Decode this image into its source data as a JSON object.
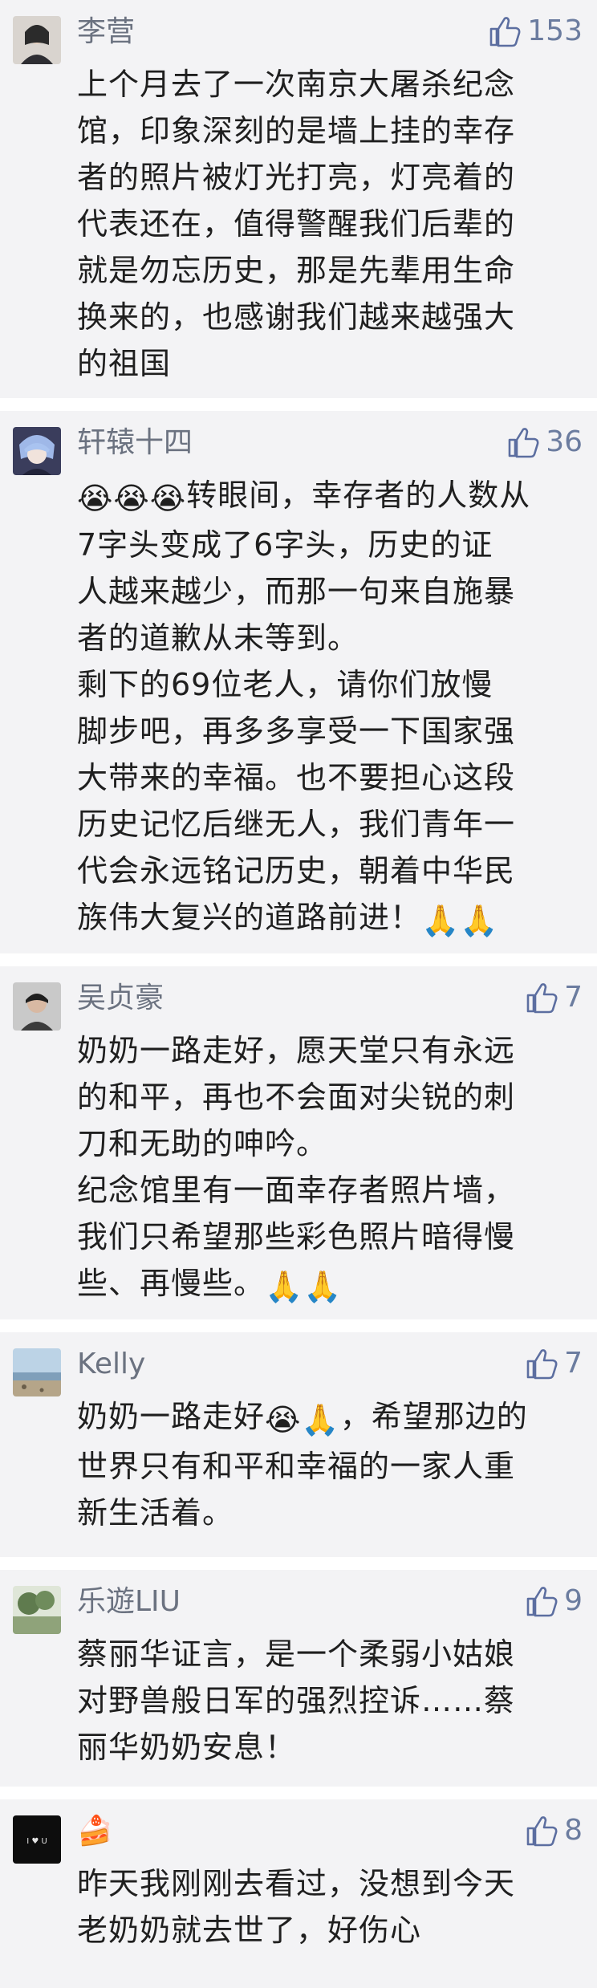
{
  "comments": [
    {
      "user": "李营",
      "likes": "153",
      "avatar": "portrait-avatar",
      "paragraphs": [
        "上个月去了一次南京大屠杀纪念\n馆，印象深刻的是墙上挂的幸存\n者的照片被灯光打亮，灯亮着的\n代表还在，值得警醒我们后辈的\n就是勿忘历史，那是先辈用生命\n换来的，也感谢我们越来越强大\n的祖国"
      ]
    },
    {
      "user": "轩辕十四",
      "likes": "36",
      "avatar": "anime-avatar",
      "emoji_prefix": "😭😭😭",
      "paragraphs": [
        "转眼间，幸存者的人数从\n7字头变成了6字头，历史的证\n人越来越少，而那一句来自施暴\n者的道歉从未等到。",
        "剩下的69位老人，请你们放慢\n脚步吧，再多多享受一下国家强\n大带来的幸福。也不要担心这段\n历史记忆后继无人，我们青年一\n代会永远铭记历史，朝着中华民\n族伟大复兴的道路前进！"
      ],
      "emoji_suffix": "🙏🙏"
    },
    {
      "user": "吴贞豪",
      "likes": "7",
      "avatar": "person-avatar",
      "paragraphs": [
        "奶奶一路走好，愿天堂只有永远\n的和平，再也不会面对尖锐的刺\n刀和无助的呻吟。",
        "纪念馆里有一面幸存者照片墙，\n我们只希望那些彩色照片暗得慢\n些、再慢些。"
      ],
      "emoji_suffix": "🙏🙏"
    },
    {
      "user": "Kelly",
      "likes": "7",
      "avatar": "beach-avatar",
      "paragraphs_rich": [
        {
          "before": "奶奶一路走好",
          "emoji": "😭🙏",
          "after": "，希望那边的\n世界只有和平和幸福的一家人重\n新生活着。"
        }
      ]
    },
    {
      "user": "乐遊LIU",
      "likes": "9",
      "avatar": "tree-avatar",
      "paragraphs": [
        "蔡丽华证言，是一个柔弱小姑娘\n对野兽般日军的强烈控诉……蔡\n丽华奶奶安息！"
      ]
    },
    {
      "user": "",
      "likes": "8",
      "avatar": "dark-avatar",
      "name_emoji": "🍰",
      "paragraphs": [
        "昨天我刚刚去看过，没想到今天\n老奶奶就去世了，好伤心"
      ]
    }
  ],
  "colors": {
    "background": "#f3f3f5",
    "username": "#6b7280",
    "like_icon": "#5c6ea0",
    "text": "#1f1f1f"
  },
  "icons": {
    "like": "thumbs-up-icon"
  }
}
